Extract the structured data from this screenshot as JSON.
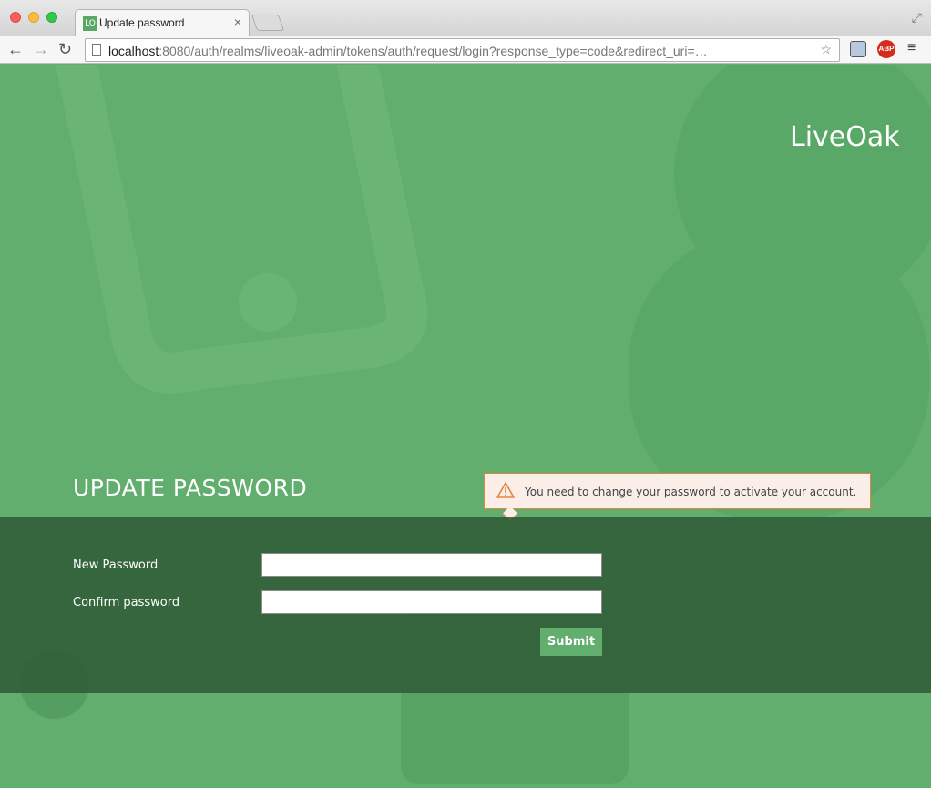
{
  "browser": {
    "tab_favicon": "LO",
    "tab_title": "Update password",
    "tab_close": "×",
    "url_host": "localhost",
    "url_rest": ":8080/auth/realms/liveoak-admin/tokens/auth/request/login?response_type=code&redirect_uri=…",
    "ext_label": "ABP"
  },
  "icons": {
    "back": "back-arrow-icon",
    "forward": "forward-arrow-icon",
    "reload": "reload-icon",
    "star": "star-icon",
    "menu": "hamburger-menu-icon",
    "warning": "warning-icon"
  },
  "page": {
    "brand": "LiveOak",
    "heading": "UPDATE PASSWORD",
    "alert_text": "You need to change your password to activate your account.",
    "form": {
      "new_password_label": "New Password",
      "confirm_password_label": "Confirm password",
      "new_password_value": "",
      "confirm_password_value": "",
      "submit_label": "Submit"
    }
  },
  "colors": {
    "page_bg": "#61ae6e",
    "panel_bg": "#3b6a44",
    "alert_border": "#e0863d",
    "button_bg": "#62ae6e"
  }
}
